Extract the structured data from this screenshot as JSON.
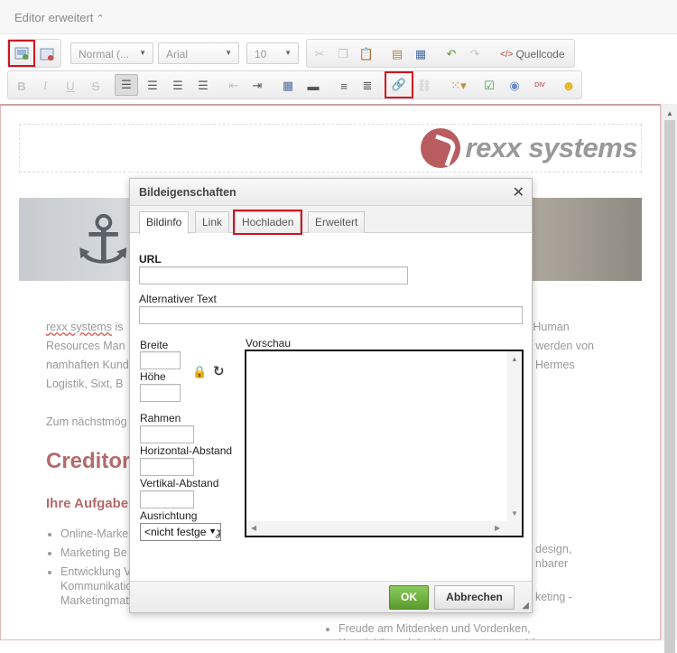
{
  "topbar": {
    "title": "Editor erweitert",
    "collapse_glyph": "⌃"
  },
  "toolbar": {
    "format_select": "Normal (...",
    "font_select": "Arial",
    "size_select": "10",
    "source_label": "Quellcode",
    "highlight_color": "#d4111f",
    "icons": [
      "image-icon",
      "flash-icon",
      "cut-icon",
      "copy-icon",
      "paste-icon",
      "paste-text-icon",
      "paste-word-icon",
      "undo-icon",
      "redo-icon",
      "source-icon",
      "bold-icon",
      "italic-icon",
      "underline-icon",
      "strike-icon",
      "align-left-icon",
      "align-center-icon",
      "align-right-icon",
      "justify-icon",
      "outdent-icon",
      "indent-icon",
      "table-icon",
      "hr-icon",
      "ordered-list-icon",
      "unordered-list-icon",
      "link-icon",
      "unlink-icon",
      "form-icon",
      "checkbox-icon",
      "radio-icon",
      "div-icon",
      "smiley-icon"
    ],
    "glyphs": {
      "bold": "B",
      "italic": "I",
      "underline": "U",
      "strike": "S",
      "div": "DIV"
    }
  },
  "document": {
    "logo_text": "rexx systems",
    "paragraph1_parts": [
      "rexx systems",
      " is",
      "en Human",
      "Resources Man",
      "en werden von",
      "namhaften Kund",
      ", Hermes",
      "Logistik, Sixt, B"
    ],
    "paragraph2": "Zum nächstmög",
    "heading_creditor": "Creditor",
    "heading_aufgaben": "Ihre Aufgabe",
    "left_list": [
      "Online-Marke Networks, Or",
      "Marketing Be unserer eBus",
      "Entwicklung Verkaufs-, Kommunikations- und Marketingmaterialien"
    ],
    "right_list": [
      "design,",
      "nbarer",
      "keting -",
      "Freude am Mitdenken und Vordenken, Kreativität und der Umsetzung neuer Ideen"
    ]
  },
  "dialog": {
    "title": "Bildeigenschaften",
    "close_glyph": "✕",
    "tabs": [
      "Bildinfo",
      "Link",
      "Hochladen",
      "Erweitert"
    ],
    "url_label": "URL",
    "url_value": "",
    "alt_label": "Alternativer Text",
    "alt_value": "",
    "width_label": "Breite",
    "height_label": "Höhe",
    "border_label": "Rahmen",
    "hspace_label": "Horizontal-Abstand",
    "vspace_label": "Vertikal-Abstand",
    "align_label": "Ausrichtung",
    "align_value": "<nicht festgelegt>",
    "preview_label": "Vorschau",
    "ok_label": "OK",
    "cancel_label": "Abbrechen",
    "ok_color": "#6aab3a"
  }
}
